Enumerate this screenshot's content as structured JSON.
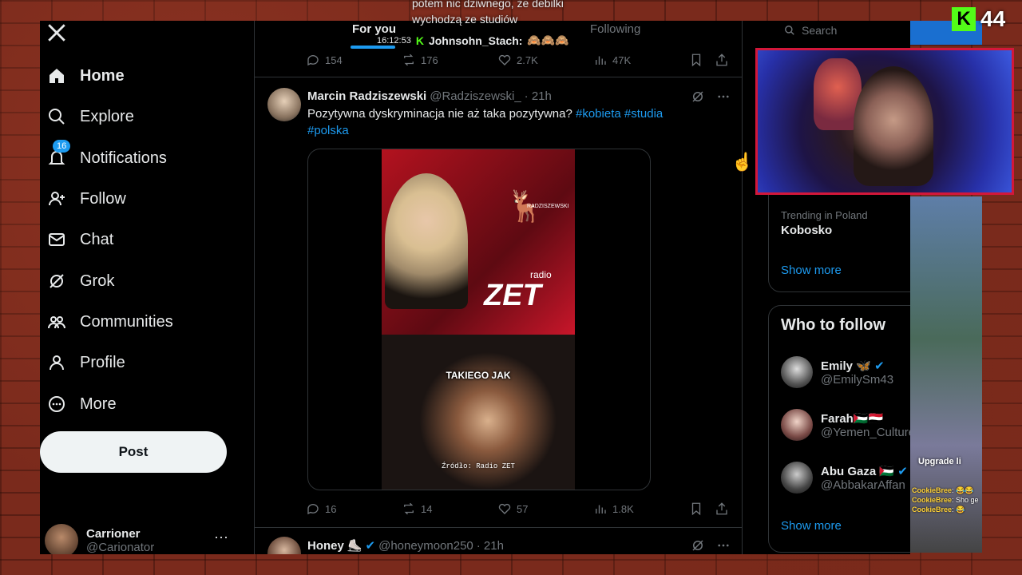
{
  "overlay": {
    "top_text_line1": "potem nic dziwnego, że debilki",
    "top_text_line2": "wychodzą ze studiów",
    "chat_time": "16:12:53",
    "chat_user": "Johnsohn_Stach:",
    "chat_msg": "🙈🙈🙈",
    "kick_logo": "K",
    "kick_count": "44",
    "game_label": "Upgrade li",
    "game_chat": [
      {
        "user": "CookieBree",
        "msg": ": 😂😂"
      },
      {
        "user": "CookieBree",
        "msg": ": Sho ge"
      },
      {
        "user": "CookieBree",
        "msg": ": 😂"
      }
    ]
  },
  "sidebar": {
    "logo": "x-logo-icon",
    "items": [
      {
        "label": "Home",
        "icon": "home-icon",
        "active": true
      },
      {
        "label": "Explore",
        "icon": "search-icon"
      },
      {
        "label": "Notifications",
        "icon": "bell-icon",
        "badge": "16"
      },
      {
        "label": "Follow",
        "icon": "follow-icon"
      },
      {
        "label": "Chat",
        "icon": "mail-icon"
      },
      {
        "label": "Grok",
        "icon": "grok-icon"
      },
      {
        "label": "Communities",
        "icon": "communities-icon"
      },
      {
        "label": "Profile",
        "icon": "profile-icon"
      },
      {
        "label": "More",
        "icon": "more-icon"
      }
    ],
    "post_label": "Post",
    "account": {
      "name": "Carrioner",
      "handle": "@Carionator",
      "more": "···"
    }
  },
  "feed": {
    "tabs": {
      "for_you": "For you",
      "following": "Following"
    },
    "prev_tweet_stats": {
      "replies": "154",
      "retweets": "176",
      "likes": "2.7K",
      "views": "47K"
    },
    "tweet": {
      "name": "Marcin Radziszewski",
      "handle": "@Radziszewski_",
      "time": "· 21h",
      "text": "Pozytywna dyskryminacja nie aż taka pozytywna?",
      "hashtags": [
        "#kobieta",
        "#studia",
        "#polska"
      ],
      "media": {
        "station": "ZET",
        "station_sub": "radio",
        "watermark": "RADZISZEWSKI",
        "caption": "TAKIEGO JAK",
        "source": "Źródło: Radio ZET"
      },
      "stats": {
        "replies": "16",
        "retweets": "14",
        "likes": "57",
        "views": "1.8K"
      }
    },
    "next_tweet": {
      "name": "Honey",
      "emoji": "⛸️",
      "handle": "@honeymoon250",
      "time": "· 21h"
    }
  },
  "right": {
    "search_placeholder": "Search",
    "trend_label": "Trending in Poland",
    "trend_name": "Kobosko",
    "show_more": "Show more",
    "who_to_follow": "Who to follow",
    "follows": [
      {
        "name": "Emily",
        "emoji": "🦋",
        "handle": "@EmilySm43"
      },
      {
        "name": "Farah",
        "emoji": "🇵🇸🇾🇪",
        "handle": "@Yemen_Culture"
      },
      {
        "name": "Abu Gaza",
        "emoji": "🇵🇸",
        "handle": "@AbbakarAffan"
      }
    ],
    "show_more_2": "Show more"
  }
}
